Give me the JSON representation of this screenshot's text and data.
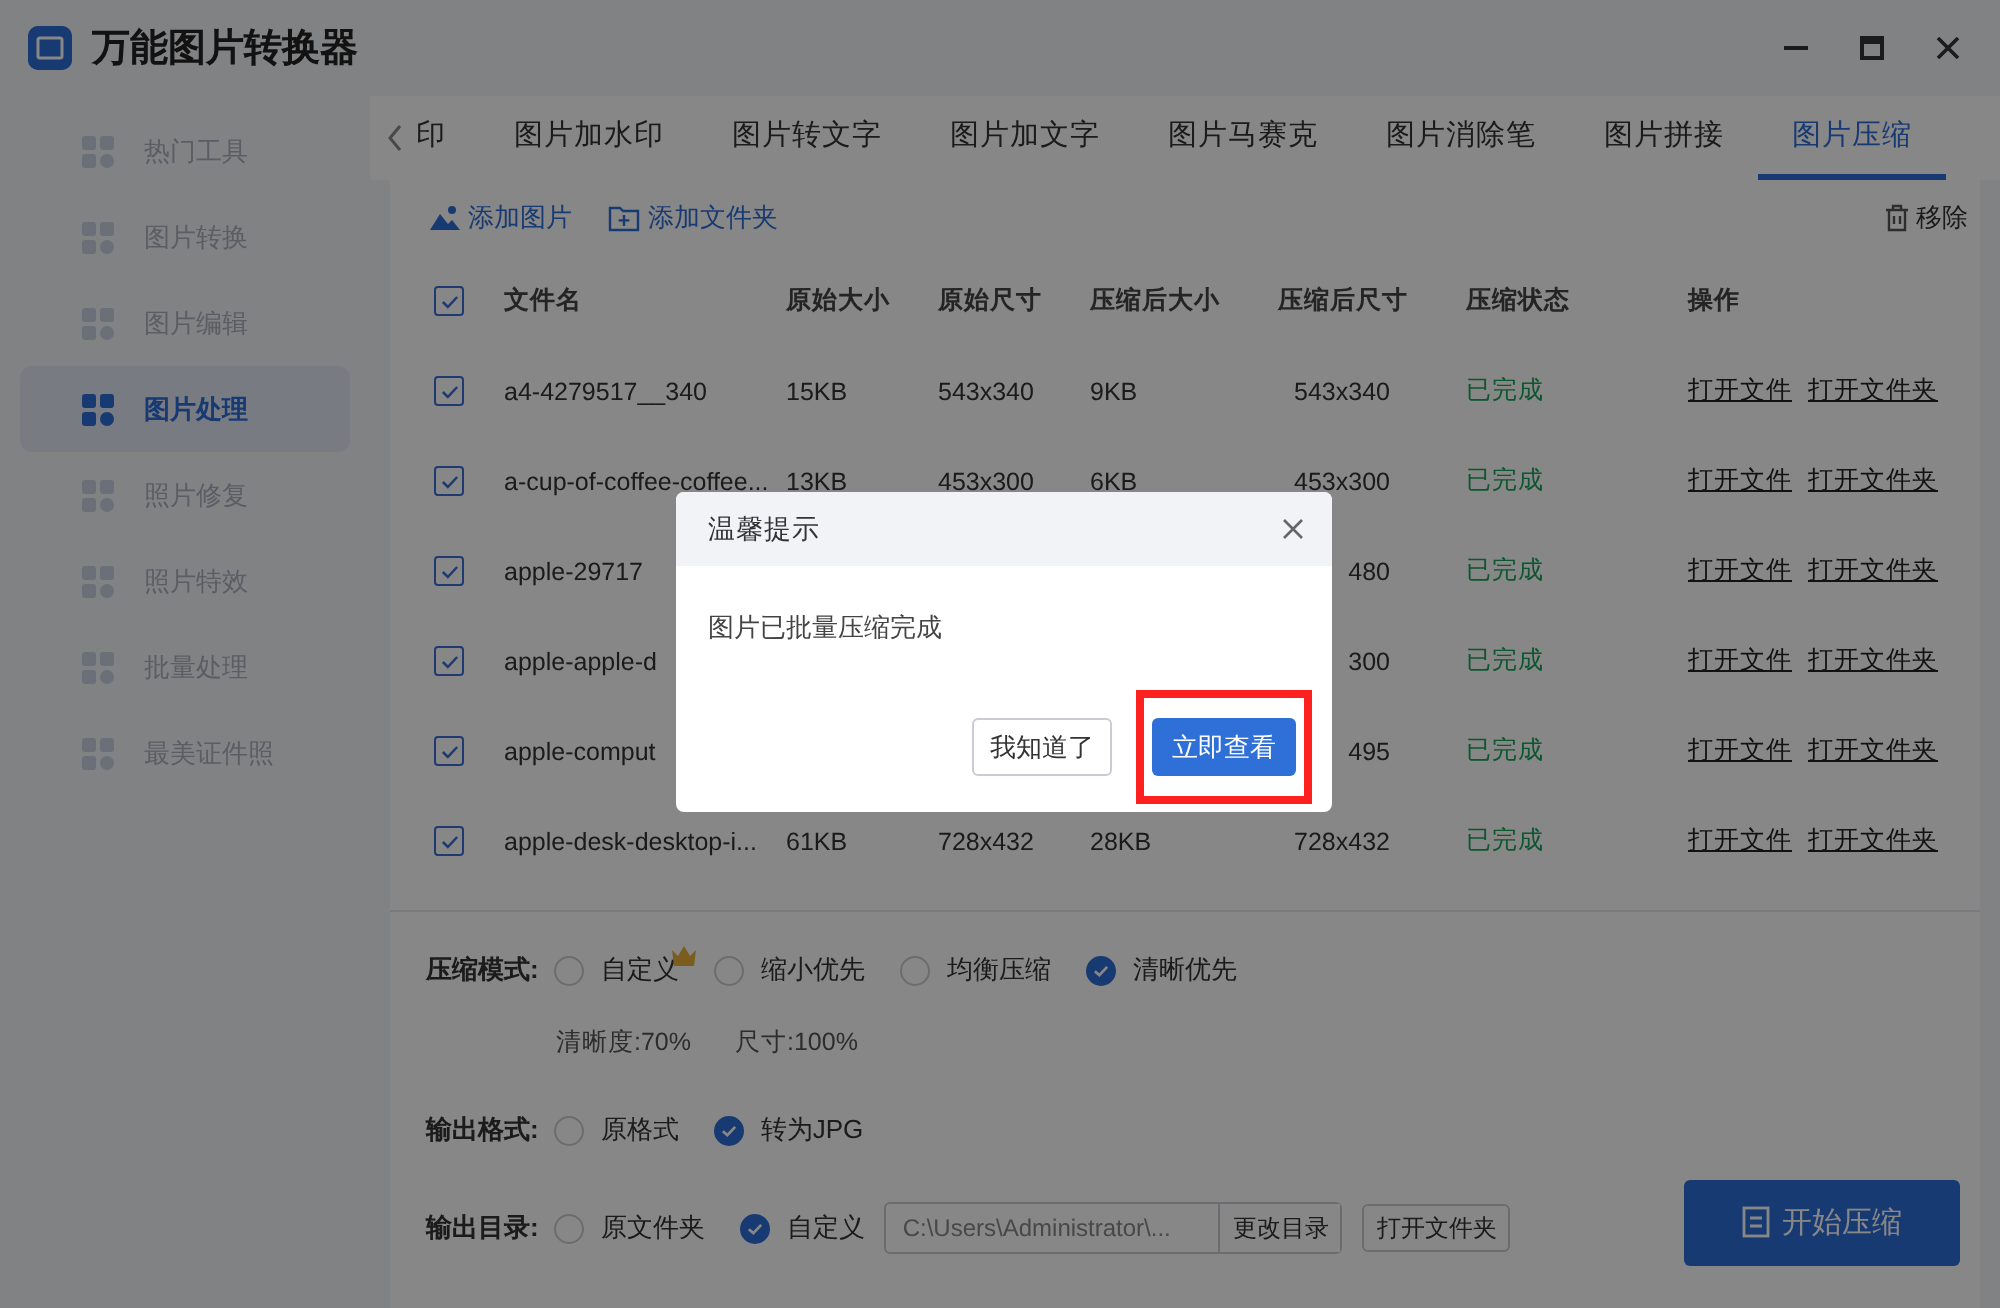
{
  "window": {
    "title": "万能图片转换器"
  },
  "sidebar": {
    "items": [
      {
        "label": "热门工具",
        "selected": false
      },
      {
        "label": "图片转换",
        "selected": false
      },
      {
        "label": "图片编辑",
        "selected": false
      },
      {
        "label": "图片处理",
        "selected": true
      },
      {
        "label": "照片修复",
        "selected": false
      },
      {
        "label": "照片特效",
        "selected": false
      },
      {
        "label": "批量处理",
        "selected": false
      },
      {
        "label": "最美证件照",
        "selected": false
      }
    ]
  },
  "tabs": {
    "items": [
      {
        "label": "印",
        "selected": false
      },
      {
        "label": "图片加水印",
        "selected": false
      },
      {
        "label": "图片转文字",
        "selected": false
      },
      {
        "label": "图片加文字",
        "selected": false
      },
      {
        "label": "图片马赛克",
        "selected": false
      },
      {
        "label": "图片消除笔",
        "selected": false
      },
      {
        "label": "图片拼接",
        "selected": false
      },
      {
        "label": "图片压缩",
        "selected": true
      }
    ]
  },
  "toolbar": {
    "add_image": "添加图片",
    "add_folder": "添加文件夹",
    "remove": "移除"
  },
  "table": {
    "all_checked": true,
    "columns": [
      "文件名",
      "原始大小",
      "原始尺寸",
      "压缩后大小",
      "压缩后尺寸",
      "压缩状态",
      "操作"
    ],
    "rows": [
      {
        "checked": true,
        "cells": {
          "name": "a4-4279517__340",
          "orig_size": "15KB",
          "orig_dims": "543x340",
          "comp_size": "9KB",
          "comp_dims": "543x340"
        },
        "status": "已完成",
        "actions": [
          "打开文件",
          "打开文件夹"
        ]
      },
      {
        "checked": true,
        "cells": {
          "name": "a-cup-of-coffee-coffee...",
          "orig_size": "13KB",
          "orig_dims": "453x300",
          "comp_size": "6KB",
          "comp_dims": "453x300"
        },
        "status": "已完成",
        "actions": [
          "打开文件",
          "打开文件夹"
        ]
      },
      {
        "checked": true,
        "cells": {
          "name": "apple-29717",
          "comp_dims": "480"
        },
        "status": "已完成",
        "actions": [
          "打开文件",
          "打开文件夹"
        ]
      },
      {
        "checked": true,
        "cells": {
          "name": "apple-apple-d",
          "comp_dims": "300"
        },
        "status": "已完成",
        "actions": [
          "打开文件",
          "打开文件夹"
        ]
      },
      {
        "checked": true,
        "cells": {
          "name": "apple-comput",
          "comp_dims": "495"
        },
        "status": "已完成",
        "actions": [
          "打开文件",
          "打开文件夹"
        ]
      },
      {
        "checked": true,
        "cells": {
          "name": "apple-desk-desktop-i...",
          "orig_size": "61KB",
          "orig_dims": "728x432",
          "comp_size": "28KB",
          "comp_dims": "728x432"
        },
        "status": "已完成",
        "actions": [
          "打开文件",
          "打开文件夹"
        ]
      }
    ]
  },
  "options": {
    "mode": {
      "label": "压缩模式:",
      "choices": [
        {
          "label": "自定义",
          "selected": false,
          "vip": true
        },
        {
          "label": "缩小优先",
          "selected": false
        },
        {
          "label": "均衡压缩",
          "selected": false
        },
        {
          "label": "清晰优先",
          "selected": true
        }
      ]
    },
    "detail": [
      "清晰度:70%",
      "尺寸:100%"
    ],
    "format": {
      "label": "输出格式:",
      "choices": [
        {
          "label": "原格式",
          "selected": false
        },
        {
          "label": "转为JPG",
          "selected": true
        }
      ]
    },
    "output": {
      "label": "输出目录:",
      "choices": [
        {
          "label": "原文件夹",
          "selected": false
        },
        {
          "label": "自定义",
          "selected": true
        }
      ],
      "path": "C:\\Users\\Administrator\\...",
      "change_button": "更改目录",
      "open_button": "打开文件夹"
    },
    "start_button": "开始压缩"
  },
  "dialog": {
    "title": "温馨提示",
    "message": "图片已批量压缩完成",
    "buttons": [
      {
        "label": "我知道了",
        "kind": "secondary",
        "highlighted": false
      },
      {
        "label": "立即查看",
        "kind": "primary",
        "highlighted": true
      }
    ]
  }
}
